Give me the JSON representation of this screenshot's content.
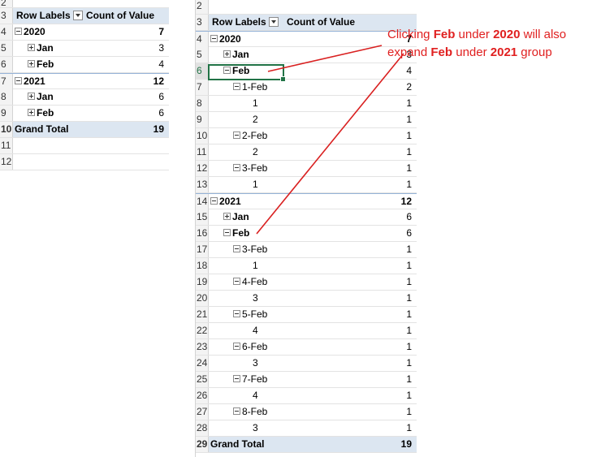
{
  "left_table": {
    "partial_top_row": "2",
    "header": {
      "row_labels": "Row Labels",
      "count_of_value": "Count of Value"
    },
    "rows": [
      {
        "rownum": "3",
        "label": "",
        "value": "",
        "type": "header"
      },
      {
        "rownum": "4",
        "label": "2020",
        "value": "7",
        "type": "group",
        "btn": "minus"
      },
      {
        "rownum": "5",
        "label": "Jan",
        "value": "3",
        "type": "month",
        "btn": "plus"
      },
      {
        "rownum": "6",
        "label": "Feb",
        "value": "4",
        "type": "month",
        "btn": "plus"
      },
      {
        "rownum": "7",
        "label": "2021",
        "value": "12",
        "type": "group",
        "btn": "minus"
      },
      {
        "rownum": "8",
        "label": "Jan",
        "value": "6",
        "type": "month",
        "btn": "plus"
      },
      {
        "rownum": "9",
        "label": "Feb",
        "value": "6",
        "type": "month",
        "btn": "plus"
      },
      {
        "rownum": "10",
        "label": "Grand Total",
        "value": "19",
        "type": "total"
      },
      {
        "rownum": "11",
        "label": "",
        "value": "",
        "type": "empty"
      },
      {
        "rownum": "12",
        "label": "",
        "value": "",
        "type": "empty"
      }
    ]
  },
  "right_table": {
    "header": {
      "row_labels": "Row Labels",
      "count_of_value": "Count of Value"
    },
    "rows": [
      {
        "rownum": "2",
        "label": "",
        "value": "",
        "type": "empty"
      },
      {
        "rownum": "3",
        "label": "",
        "value": "",
        "type": "header"
      },
      {
        "rownum": "4",
        "label": "2020",
        "value": "7",
        "type": "group",
        "btn": "minus"
      },
      {
        "rownum": "5",
        "label": "Jan",
        "value": "3",
        "type": "month",
        "btn": "plus"
      },
      {
        "rownum": "6",
        "label": "Feb",
        "value": "4",
        "type": "month",
        "btn": "minus",
        "selected": true
      },
      {
        "rownum": "7",
        "label": "1-Feb",
        "value": "2",
        "type": "day",
        "btn": "minus"
      },
      {
        "rownum": "8",
        "label": "1",
        "value": "1",
        "type": "leaf"
      },
      {
        "rownum": "9",
        "label": "2",
        "value": "1",
        "type": "leaf"
      },
      {
        "rownum": "10",
        "label": "2-Feb",
        "value": "1",
        "type": "day",
        "btn": "minus"
      },
      {
        "rownum": "11",
        "label": "2",
        "value": "1",
        "type": "leaf"
      },
      {
        "rownum": "12",
        "label": "3-Feb",
        "value": "1",
        "type": "day",
        "btn": "minus"
      },
      {
        "rownum": "13",
        "label": "1",
        "value": "1",
        "type": "leaf"
      },
      {
        "rownum": "14",
        "label": "2021",
        "value": "12",
        "type": "group",
        "btn": "minus"
      },
      {
        "rownum": "15",
        "label": "Jan",
        "value": "6",
        "type": "month",
        "btn": "plus"
      },
      {
        "rownum": "16",
        "label": "Feb",
        "value": "6",
        "type": "month",
        "btn": "minus"
      },
      {
        "rownum": "17",
        "label": "3-Feb",
        "value": "1",
        "type": "day",
        "btn": "minus"
      },
      {
        "rownum": "18",
        "label": "1",
        "value": "1",
        "type": "leaf"
      },
      {
        "rownum": "19",
        "label": "4-Feb",
        "value": "1",
        "type": "day",
        "btn": "minus"
      },
      {
        "rownum": "20",
        "label": "3",
        "value": "1",
        "type": "leaf"
      },
      {
        "rownum": "21",
        "label": "5-Feb",
        "value": "1",
        "type": "day",
        "btn": "minus"
      },
      {
        "rownum": "22",
        "label": "4",
        "value": "1",
        "type": "leaf"
      },
      {
        "rownum": "23",
        "label": "6-Feb",
        "value": "1",
        "type": "day",
        "btn": "minus"
      },
      {
        "rownum": "24",
        "label": "3",
        "value": "1",
        "type": "leaf"
      },
      {
        "rownum": "25",
        "label": "7-Feb",
        "value": "1",
        "type": "day",
        "btn": "minus"
      },
      {
        "rownum": "26",
        "label": "4",
        "value": "1",
        "type": "leaf"
      },
      {
        "rownum": "27",
        "label": "8-Feb",
        "value": "1",
        "type": "day",
        "btn": "minus"
      },
      {
        "rownum": "28",
        "label": "3",
        "value": "1",
        "type": "leaf"
      },
      {
        "rownum": "29",
        "label": "Grand Total",
        "value": "19",
        "type": "total"
      }
    ]
  },
  "annotation": {
    "parts": [
      {
        "text": "Clicking ",
        "bold": false
      },
      {
        "text": "Feb",
        "bold": true
      },
      {
        "text": " under ",
        "bold": false
      },
      {
        "text": "2020",
        "bold": true
      },
      {
        "text": " will also expand ",
        "bold": false
      },
      {
        "text": "Feb",
        "bold": true
      },
      {
        "text": " under ",
        "bold": false
      },
      {
        "text": "2021",
        "bold": true
      },
      {
        "text": " group",
        "bold": false
      }
    ],
    "color": "#e02020"
  }
}
